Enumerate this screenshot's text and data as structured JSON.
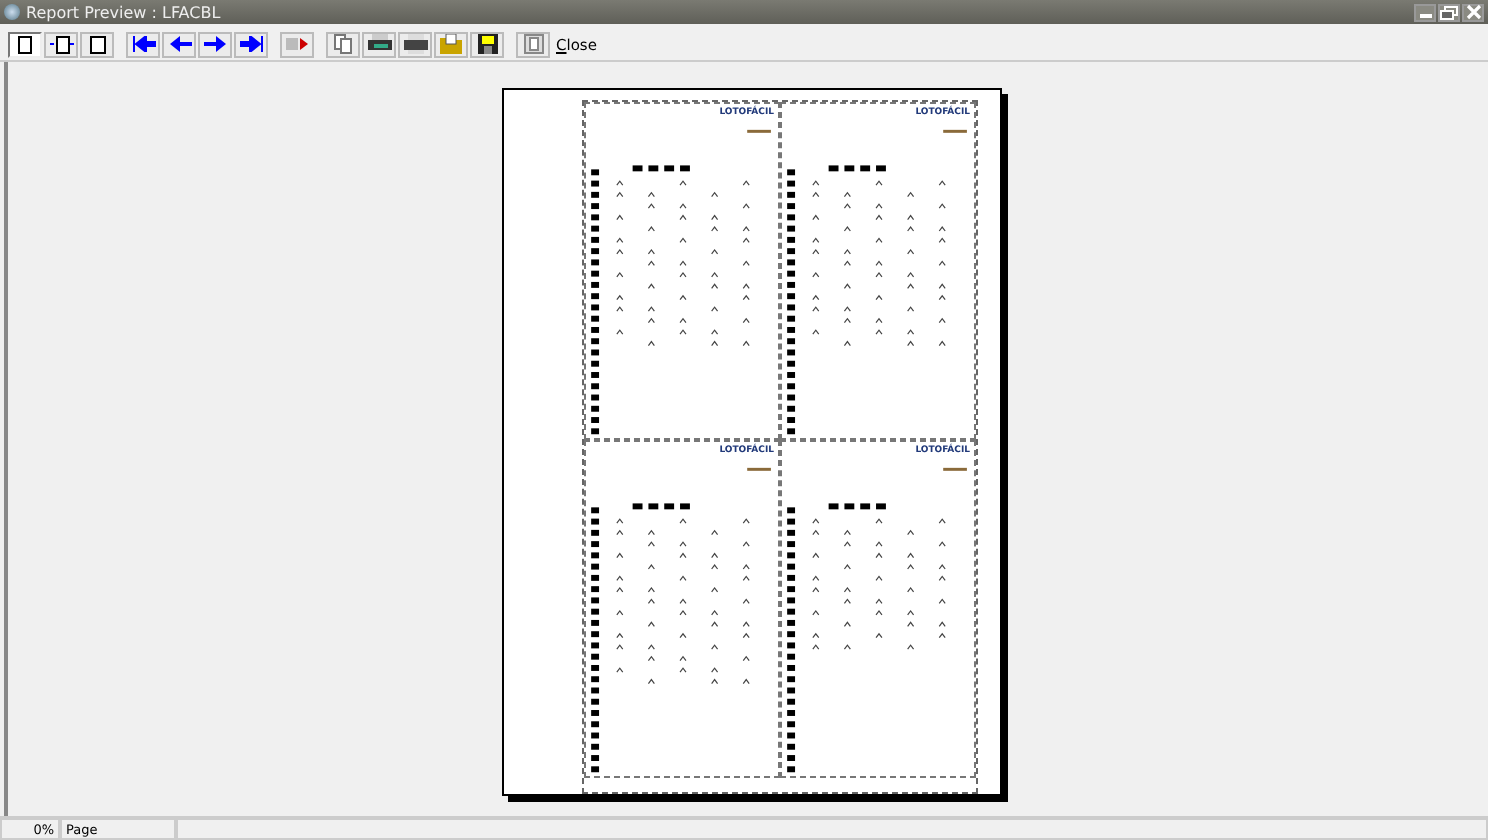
{
  "window": {
    "title": "Report Preview : LFACBL"
  },
  "toolbar": {
    "close_label": "Close"
  },
  "page": {
    "cards": [
      {
        "brand": "LOTOFÁCIL"
      },
      {
        "brand": "LOTOFÁCIL"
      },
      {
        "brand": "LOTOFÁCIL"
      },
      {
        "brand": "LOTOFÁCIL"
      }
    ]
  },
  "status_bar": {
    "zoom": "0%",
    "label": "Page"
  }
}
